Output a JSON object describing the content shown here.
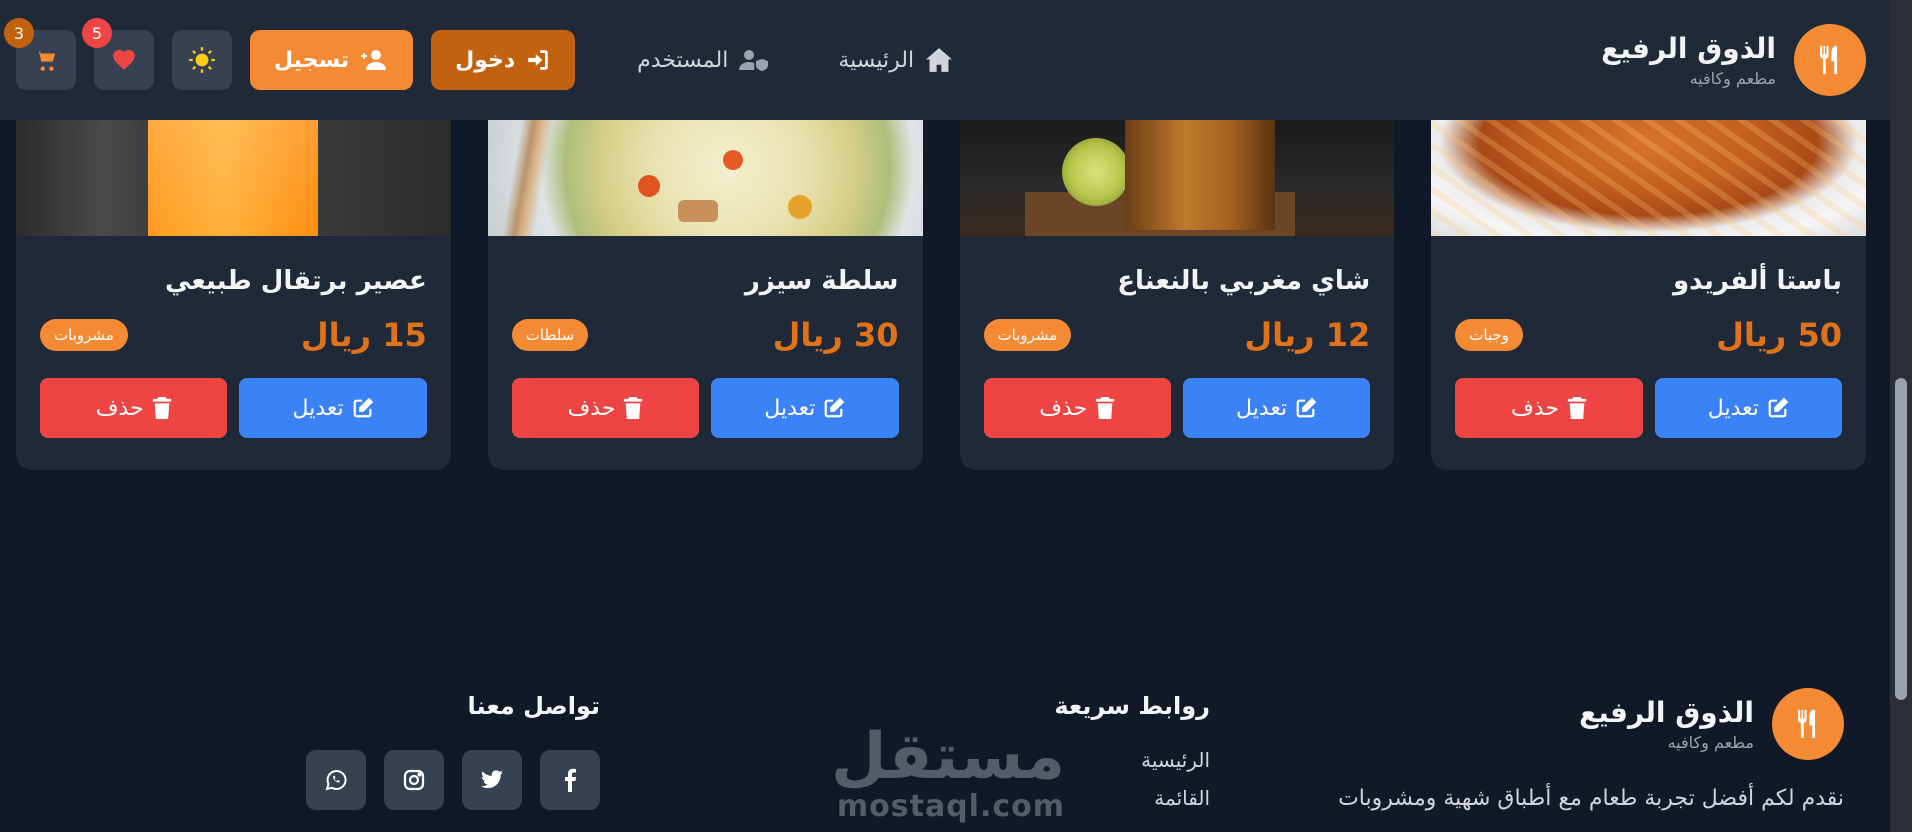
{
  "navbar": {
    "brand_title": "الذوق الرفيع",
    "brand_subtitle": "مطعم وكافيه",
    "links": [
      {
        "label": "الرئيسية",
        "icon": "home-icon"
      },
      {
        "label": "المستخدم",
        "icon": "user-shield-icon"
      }
    ],
    "login_label": "دخول",
    "register_label": "تسجيل",
    "cart_count": "3",
    "favorites_count": "5"
  },
  "products": [
    {
      "title": "عصير برتقال طبيعي",
      "price": "15 ريال",
      "category": "مشروبات",
      "edit_label": "تعديل",
      "delete_label": "حذف"
    },
    {
      "title": "سلطة سيزر",
      "price": "30 ريال",
      "category": "سلطات",
      "edit_label": "تعديل",
      "delete_label": "حذف"
    },
    {
      "title": "شاي مغربي بالنعناع",
      "price": "12 ريال",
      "category": "مشروبات",
      "edit_label": "تعديل",
      "delete_label": "حذف"
    },
    {
      "title": "باستا ألفريدو",
      "price": "50 ريال",
      "category": "وجبات",
      "edit_label": "تعديل",
      "delete_label": "حذف"
    }
  ],
  "footer": {
    "brand_title": "الذوق الرفيع",
    "brand_subtitle": "مطعم وكافيه",
    "description": "نقدم لكم أفضل تجربة طعام مع أطباق شهية ومشروبات",
    "quick_links_title": "روابط سريعة",
    "quick_links": [
      "الرئيسية",
      "القائمة"
    ],
    "contact_title": "تواصل معنا"
  },
  "watermark": {
    "arabic": "مستقل",
    "latin": "mostaql.com"
  },
  "colors": {
    "accent": "#f58a34",
    "accent_dark": "#c2620f",
    "edit": "#3b82f6",
    "delete": "#ef4444",
    "navbar": "#1f2937",
    "background": "#111827"
  }
}
